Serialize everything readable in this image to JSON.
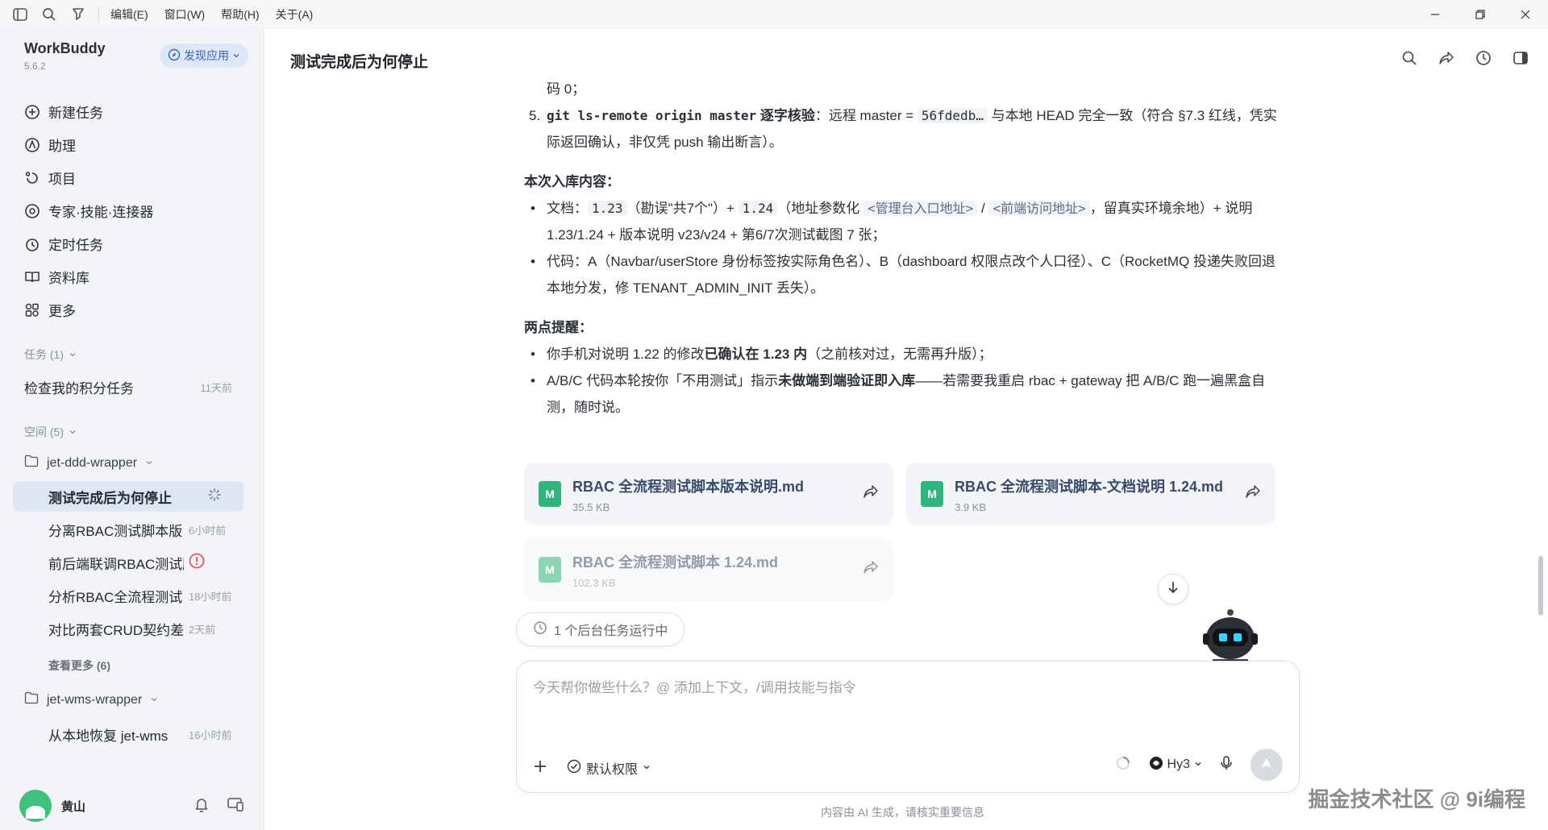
{
  "titlebar": {
    "menus": [
      "编辑(E)",
      "窗口(W)",
      "帮助(H)",
      "关于(A)"
    ],
    "icons": [
      "sidebar-toggle-icon",
      "search-icon",
      "pin-icon"
    ]
  },
  "sidebar": {
    "brand": "WorkBuddy",
    "version": "5.6.2",
    "discover_label": "发现应用",
    "nav": [
      {
        "label": "新建任务",
        "icon": "plus-circle-icon"
      },
      {
        "label": "助理",
        "icon": "assistant-icon"
      },
      {
        "label": "项目",
        "icon": "project-icon"
      },
      {
        "label": "专家·技能·连接器",
        "icon": "expert-icon"
      },
      {
        "label": "定时任务",
        "icon": "clock-icon"
      },
      {
        "label": "资料库",
        "icon": "book-icon"
      },
      {
        "label": "更多",
        "icon": "grid-icon"
      }
    ],
    "tasks_header": "任务 (1)",
    "tasks": [
      {
        "label": "检查我的积分任务",
        "time": "11天前"
      }
    ],
    "spaces_header": "空间 (5)",
    "folders": [
      {
        "name": "jet-ddd-wrapper",
        "items": [
          {
            "label": "测试完成后为何停止",
            "time": ""
          },
          {
            "label": "分离RBAC测试脚本版",
            "time": "6小时前"
          },
          {
            "label": "前后端联调RBAC测试脚本",
            "time": ""
          },
          {
            "label": "分析RBAC全流程测试",
            "time": "18小时前"
          },
          {
            "label": "对比两套CRUD契约差异",
            "time": "2天前"
          }
        ],
        "see_more": "查看更多 (6)"
      },
      {
        "name": "jet-wms-wrapper",
        "items": [
          {
            "label": "从本地恢复 jet-wms",
            "time": "16小时前"
          }
        ]
      }
    ],
    "user": {
      "name": "黄山"
    }
  },
  "main": {
    "title": "测试完成后为何停止",
    "content": {
      "line0": "码 0；",
      "item5_num": "5.",
      "item5_code": "git ls-remote origin master",
      "item5_bold": " 逐字核验",
      "item5_text1": "：远程 master = ",
      "item5_hash": "56fdedb…",
      "item5_text2": " 与本地 HEAD 完全一致（符合 §7.3 红线，凭实际返回确认，非仅凭 push 输出断言）。",
      "h1": "本次入库内容：",
      "b1_prefix": "文档：",
      "b1_code1": "1.23",
      "b1_text1": "（勘误\"共7个\"）+ ",
      "b1_code2": "1.24",
      "b1_text2": "（地址参数化 ",
      "b1_link1": "<管理台入口地址>",
      "b1_slash": " / ",
      "b1_link2": "<前端访问地址>",
      "b1_text3": "，留真实环境余地）+ 说明 1.23/1.24 + 版本说明 v23/v24 + 第6/7次测试截图 7 张；",
      "b2": "代码：A（Navbar/userStore 身份标签按实际角色名）、B（dashboard 权限点改个人口径）、C（RocketMQ 投递失败回退本地分发，修 TENANT_ADMIN_INIT 丢失）。",
      "h2": "两点提醒：",
      "r1_text1": "你手机对说明 1.22 的修改",
      "r1_bold": "已确认在 1.23 内",
      "r1_text2": "（之前核对过，无需再升版）；",
      "r2_text1": "A/B/C 代码本轮按你「不用测试」指示",
      "r2_bold": "未做端到端验证即入库",
      "r2_text2": "——若需要我重启 rbac + gateway 把 A/B/C 跑一遍黑盒自测，随时说。"
    },
    "files": [
      {
        "name": "RBAC 全流程测试脚本版本说明.md",
        "size": "35.5 KB"
      },
      {
        "name": "RBAC 全流程测试脚本-文档说明 1.24.md",
        "size": "3.9 KB"
      },
      {
        "name": "RBAC 全流程测试脚本 1.24.md",
        "size": "102.3 KB"
      }
    ],
    "file_icon_letter": "M",
    "bg_task": "1 个后台任务运行中",
    "composer": {
      "placeholder": "今天帮你做些什么？@ 添加上下文，/调用技能与指令",
      "permission": "默认权限",
      "model": "Hy3"
    },
    "disclaimer": "内容由 AI 生成，请核实重要信息",
    "watermark": "掘金技术社区 @ 9i编程"
  },
  "colors": {
    "accent": "#3a64b8",
    "file_icon": "#2fb67c",
    "alert": "#e5484d"
  }
}
